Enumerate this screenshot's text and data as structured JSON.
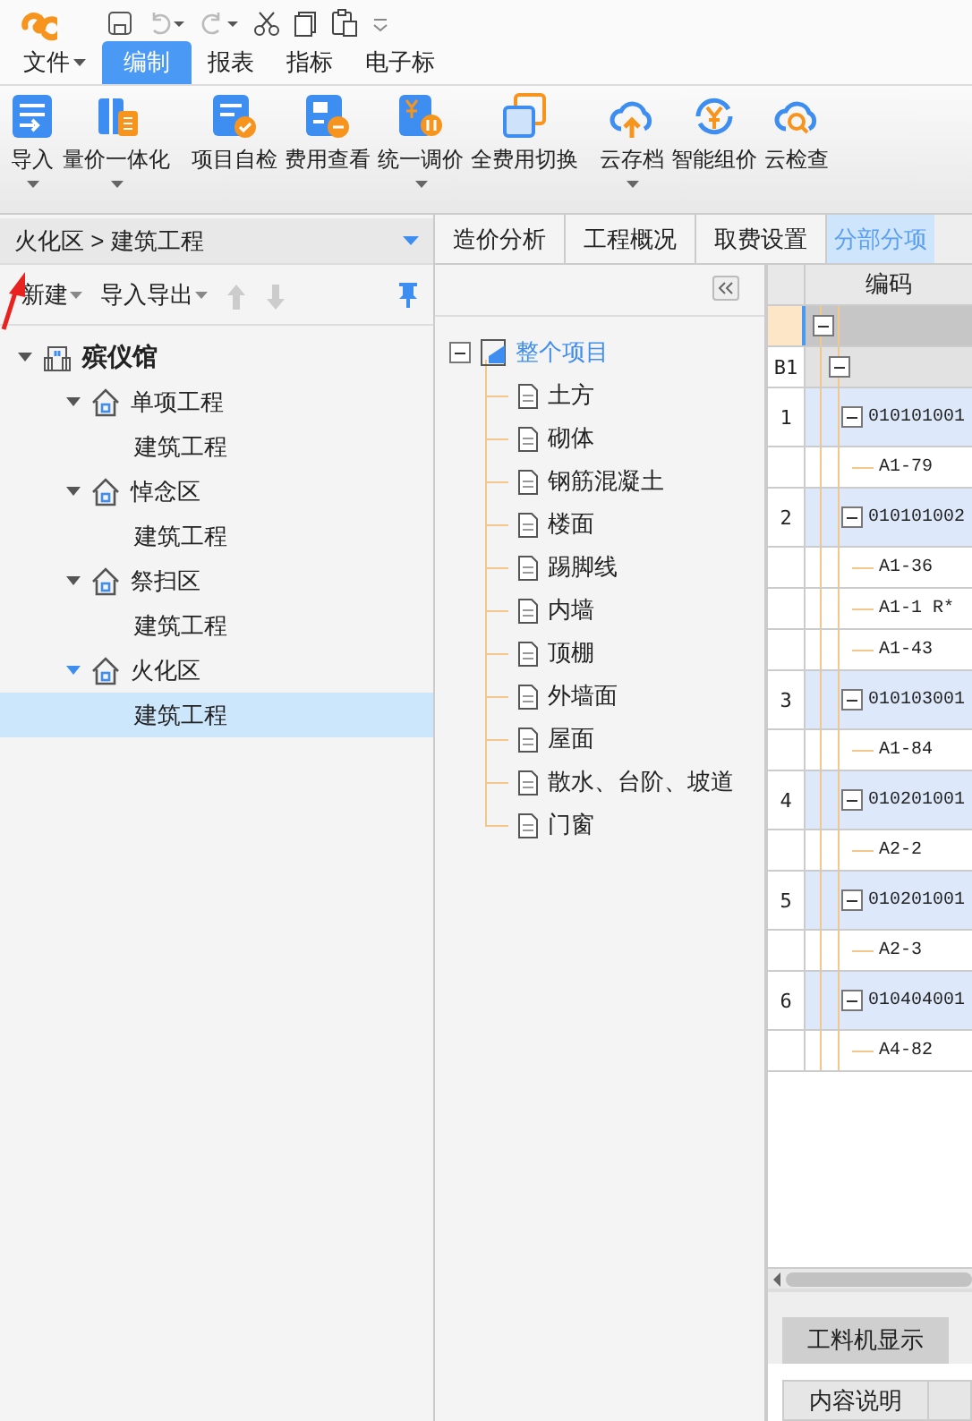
{
  "menu_tabs": [
    {
      "label": "文件",
      "dropdown": true,
      "selected": false
    },
    {
      "label": "编制",
      "dropdown": false,
      "selected": true
    },
    {
      "label": "报表",
      "dropdown": false,
      "selected": false
    },
    {
      "label": "指标",
      "dropdown": false,
      "selected": false
    },
    {
      "label": "电子标",
      "dropdown": false,
      "selected": false
    }
  ],
  "ribbon_groups": [
    [
      {
        "label": "导入",
        "kind": "import",
        "dropdown": true
      },
      {
        "label": "量价一体化",
        "kind": "integrate",
        "dropdown": true
      }
    ],
    [
      {
        "label": "项目自检",
        "kind": "check",
        "dropdown": false
      },
      {
        "label": "费用查看",
        "kind": "fee",
        "dropdown": false
      },
      {
        "label": "统一调价",
        "kind": "adjust",
        "dropdown": true
      },
      {
        "label": "全费用切换",
        "kind": "switch",
        "dropdown": false
      }
    ],
    [
      {
        "label": "云存档",
        "kind": "cloud-up",
        "dropdown": true
      },
      {
        "label": "智能组价",
        "kind": "cloud-yen",
        "dropdown": false
      },
      {
        "label": "云检查",
        "kind": "cloud-search",
        "dropdown": false
      }
    ]
  ],
  "project_panel": {
    "breadcrumb": "火化区 > 建筑工程",
    "toolbar": [
      {
        "label": "新建",
        "dropdown": true
      },
      {
        "label": "导入导出",
        "dropdown": true
      }
    ],
    "tree": {
      "label": "殡仪馆",
      "expanded": true,
      "children": [
        {
          "label": "单项工程",
          "expanded": true,
          "current": false,
          "children": [
            {
              "label": "建筑工程",
              "selected": false
            }
          ]
        },
        {
          "label": "悼念区",
          "expanded": true,
          "current": false,
          "children": [
            {
              "label": "建筑工程",
              "selected": false
            }
          ]
        },
        {
          "label": "祭扫区",
          "expanded": true,
          "current": false,
          "children": [
            {
              "label": "建筑工程",
              "selected": false
            }
          ]
        },
        {
          "label": "火化区",
          "expanded": true,
          "current": true,
          "children": [
            {
              "label": "建筑工程",
              "selected": true
            }
          ]
        }
      ]
    }
  },
  "view_tabs": [
    {
      "label": "造价分析",
      "selected": false
    },
    {
      "label": "工程概况",
      "selected": false
    },
    {
      "label": "取费设置",
      "selected": false
    },
    {
      "label": "分部分项",
      "selected": true
    }
  ],
  "section_tree": {
    "label": "整个项目",
    "expanded": true,
    "children": [
      {
        "label": "土方"
      },
      {
        "label": "砌体"
      },
      {
        "label": "钢筋混凝土"
      },
      {
        "label": "楼面"
      },
      {
        "label": "踢脚线"
      },
      {
        "label": "内墙"
      },
      {
        "label": "顶棚"
      },
      {
        "label": "外墙面"
      },
      {
        "label": "屋面"
      },
      {
        "label": "散水、台阶、坡道"
      },
      {
        "label": "门窗"
      }
    ]
  },
  "grid": {
    "columns": [
      "编码"
    ],
    "rows": [
      {
        "kind": "root",
        "number": "",
        "code": ""
      },
      {
        "kind": "division",
        "number": "B1",
        "code": ""
      },
      {
        "kind": "item",
        "number": "1",
        "code": "010101001"
      },
      {
        "kind": "quota",
        "number": "",
        "code": "A1-79"
      },
      {
        "kind": "item",
        "number": "2",
        "code": "010101002"
      },
      {
        "kind": "quota",
        "number": "",
        "code": "A1-36"
      },
      {
        "kind": "quota",
        "number": "",
        "code": "A1-1 R*"
      },
      {
        "kind": "quota",
        "number": "",
        "code": "A1-43"
      },
      {
        "kind": "item",
        "number": "3",
        "code": "010103001"
      },
      {
        "kind": "quota",
        "number": "",
        "code": "A1-84"
      },
      {
        "kind": "item",
        "number": "4",
        "code": "010201001"
      },
      {
        "kind": "quota",
        "number": "",
        "code": "A2-2"
      },
      {
        "kind": "item",
        "number": "5",
        "code": "010201001"
      },
      {
        "kind": "quota",
        "number": "",
        "code": "A2-3"
      },
      {
        "kind": "item",
        "number": "6",
        "code": "010404001"
      },
      {
        "kind": "quota",
        "number": "",
        "code": "A4-82"
      }
    ]
  },
  "bottom_tabs": [
    {
      "label": "工料机显示"
    }
  ],
  "detail_columns": [
    "内容说明"
  ]
}
